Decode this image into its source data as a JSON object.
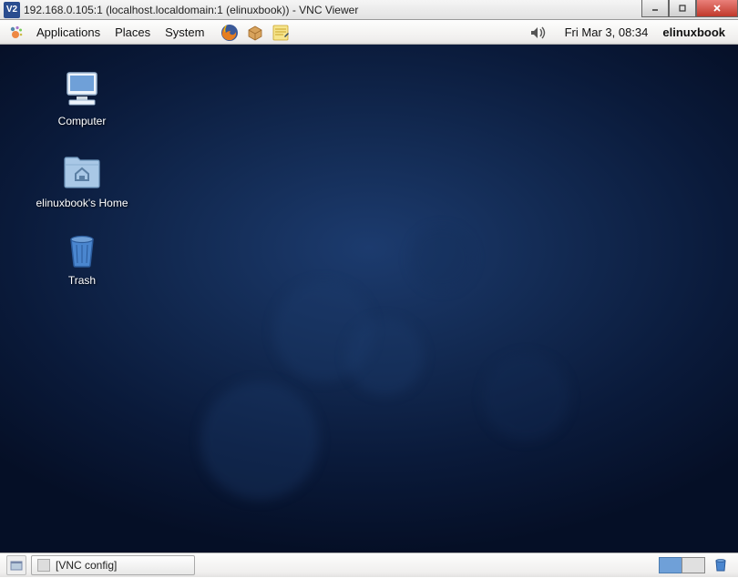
{
  "window": {
    "title": "192.168.0.105:1 (localhost.localdomain:1 (elinuxbook)) - VNC Viewer",
    "logo_text": "V2"
  },
  "panel_top": {
    "menus": {
      "applications": "Applications",
      "places": "Places",
      "system": "System"
    },
    "clock": "Fri Mar  3, 08:34",
    "username": "elinuxbook"
  },
  "desktop": {
    "icons": [
      {
        "label": "Computer"
      },
      {
        "label": "elinuxbook's Home"
      },
      {
        "label": "Trash"
      }
    ]
  },
  "panel_bot": {
    "task": "[VNC config]"
  }
}
